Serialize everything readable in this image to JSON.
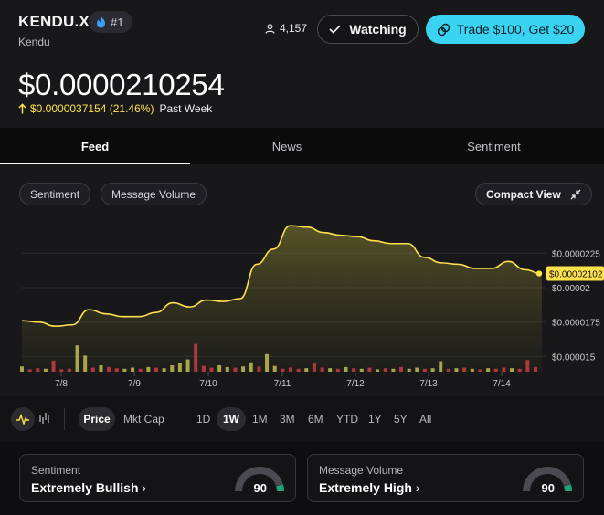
{
  "header": {
    "ticker": "KENDU.X",
    "rank": "#1",
    "company": "Kendu",
    "watchers": "4,157",
    "watch_label": "Watching",
    "trade_label": "Trade $100, Get $20"
  },
  "price": {
    "value": "$0.0000210254",
    "change": "$0.0000037154 (21.46%)",
    "period": "Past Week",
    "accent_color": "#ffe14d"
  },
  "tabs": [
    {
      "label": "Feed",
      "active": true
    },
    {
      "label": "News",
      "active": false
    },
    {
      "label": "Sentiment",
      "active": false
    }
  ],
  "chart_filters": {
    "sentiment": "Sentiment",
    "message_volume": "Message Volume",
    "compact_view": "Compact View"
  },
  "chart_data": {
    "type": "area",
    "title": "",
    "x_labels": [
      "7/8",
      "7/9",
      "7/10",
      "7/11",
      "7/12",
      "7/13",
      "7/14"
    ],
    "y_tick_labels": [
      "$0.0000225",
      "$0.00002",
      "$0.0000175",
      "$0.000015"
    ],
    "y_ticks": [
      2.25e-05,
      2e-05,
      1.75e-05,
      1.5e-05
    ],
    "ylim": [
      1.39e-05,
      2.63e-05
    ],
    "last_price_label": "$0.00002102",
    "last_price": 2.10254e-05,
    "price_series": [
      1.76e-05,
      1.75e-05,
      1.72e-05,
      1.73e-05,
      1.84e-05,
      1.81e-05,
      1.79e-05,
      1.79e-05,
      1.82e-05,
      1.89e-05,
      1.86e-05,
      1.91e-05,
      1.9e-05,
      1.92e-05,
      2.17e-05,
      2.28e-05,
      2.45e-05,
      2.44e-05,
      2.4e-05,
      2.38e-05,
      2.37e-05,
      2.34e-05,
      2.32e-05,
      2.32e-05,
      2.22e-05,
      2.18e-05,
      2.17e-05,
      2.14e-05,
      2.14e-05,
      2.19e-05,
      2.13e-05,
      2.1e-05
    ],
    "volume_bars": [
      {
        "v": 0.18,
        "c": "green"
      },
      {
        "v": 0.08,
        "c": "red"
      },
      {
        "v": 0.12,
        "c": "red"
      },
      {
        "v": 0.1,
        "c": "green"
      },
      {
        "v": 0.38,
        "c": "red"
      },
      {
        "v": 0.08,
        "c": "red"
      },
      {
        "v": 0.1,
        "c": "red"
      },
      {
        "v": 0.9,
        "c": "green"
      },
      {
        "v": 0.55,
        "c": "green"
      },
      {
        "v": 0.14,
        "c": "red"
      },
      {
        "v": 0.22,
        "c": "green"
      },
      {
        "v": 0.16,
        "c": "red"
      },
      {
        "v": 0.12,
        "c": "red"
      },
      {
        "v": 0.1,
        "c": "green"
      },
      {
        "v": 0.14,
        "c": "green"
      },
      {
        "v": 0.1,
        "c": "red"
      },
      {
        "v": 0.16,
        "c": "green"
      },
      {
        "v": 0.14,
        "c": "red"
      },
      {
        "v": 0.12,
        "c": "green"
      },
      {
        "v": 0.22,
        "c": "green"
      },
      {
        "v": 0.3,
        "c": "green"
      },
      {
        "v": 0.42,
        "c": "green"
      },
      {
        "v": 0.95,
        "c": "red"
      },
      {
        "v": 0.2,
        "c": "red"
      },
      {
        "v": 0.14,
        "c": "red"
      },
      {
        "v": 0.22,
        "c": "green"
      },
      {
        "v": 0.16,
        "c": "green"
      },
      {
        "v": 0.14,
        "c": "red"
      },
      {
        "v": 0.18,
        "c": "green"
      },
      {
        "v": 0.32,
        "c": "green"
      },
      {
        "v": 0.18,
        "c": "red"
      },
      {
        "v": 0.6,
        "c": "green"
      },
      {
        "v": 0.2,
        "c": "green"
      },
      {
        "v": 0.1,
        "c": "red"
      },
      {
        "v": 0.14,
        "c": "red"
      },
      {
        "v": 0.1,
        "c": "red"
      },
      {
        "v": 0.12,
        "c": "green"
      },
      {
        "v": 0.28,
        "c": "red"
      },
      {
        "v": 0.14,
        "c": "red"
      },
      {
        "v": 0.12,
        "c": "green"
      },
      {
        "v": 0.1,
        "c": "red"
      },
      {
        "v": 0.16,
        "c": "green"
      },
      {
        "v": 0.12,
        "c": "red"
      },
      {
        "v": 0.1,
        "c": "green"
      },
      {
        "v": 0.14,
        "c": "red"
      },
      {
        "v": 0.08,
        "c": "green"
      },
      {
        "v": 0.12,
        "c": "red"
      },
      {
        "v": 0.1,
        "c": "green"
      },
      {
        "v": 0.16,
        "c": "red"
      },
      {
        "v": 0.1,
        "c": "green"
      },
      {
        "v": 0.14,
        "c": "green"
      },
      {
        "v": 0.1,
        "c": "red"
      },
      {
        "v": 0.12,
        "c": "green"
      },
      {
        "v": 0.36,
        "c": "green"
      },
      {
        "v": 0.1,
        "c": "red"
      },
      {
        "v": 0.12,
        "c": "green"
      },
      {
        "v": 0.14,
        "c": "red"
      },
      {
        "v": 0.1,
        "c": "green"
      },
      {
        "v": 0.08,
        "c": "red"
      },
      {
        "v": 0.12,
        "c": "green"
      },
      {
        "v": 0.1,
        "c": "red"
      },
      {
        "v": 0.14,
        "c": "red"
      },
      {
        "v": 0.12,
        "c": "green"
      },
      {
        "v": 0.1,
        "c": "red"
      },
      {
        "v": 0.4,
        "c": "red"
      },
      {
        "v": 0.16,
        "c": "red"
      }
    ],
    "line_color": "#ffe14d",
    "up_color": "#a9a54a",
    "down_color": "#b0373a",
    "grid": true
  },
  "controls": {
    "price": "Price",
    "market_cap": "Mkt Cap",
    "ranges": [
      "1D",
      "1W",
      "1M",
      "3M",
      "6M",
      "YTD",
      "1Y",
      "5Y",
      "All"
    ],
    "active_range": "1W"
  },
  "cards": {
    "sentiment": {
      "label": "Sentiment",
      "value": "Extremely Bullish",
      "score": "90",
      "score_num": 90
    },
    "volume": {
      "label": "Message Volume",
      "value": "Extremely High",
      "score": "90",
      "score_num": 90
    }
  }
}
